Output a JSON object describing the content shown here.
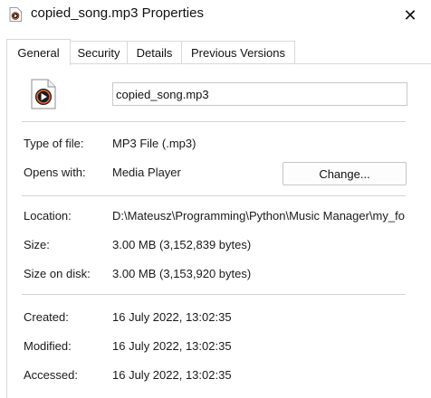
{
  "window": {
    "title": "copied_song.mp3 Properties",
    "close_symbol": "✕"
  },
  "tabs": [
    {
      "label": "General",
      "active": true
    },
    {
      "label": "Security",
      "active": false
    },
    {
      "label": "Details",
      "active": false
    },
    {
      "label": "Previous Versions",
      "active": false
    }
  ],
  "general": {
    "file_name": "copied_song.mp3",
    "type_label": "Type of file:",
    "type_value": "MP3 File (.mp3)",
    "opens_label": "Opens with:",
    "opens_value": "Media Player",
    "change_button": "Change...",
    "location_label": "Location:",
    "location_value": "D:\\Mateusz\\Programming\\Python\\Music Manager\\my_fo",
    "size_label": "Size:",
    "size_value": "3.00 MB (3,152,839 bytes)",
    "size_disk_label": "Size on disk:",
    "size_disk_value": "3.00 MB (3,153,920 bytes)",
    "created_label": "Created:",
    "created_value": "16 July 2022, 13:02:35",
    "modified_label": "Modified:",
    "modified_value": "16 July 2022, 13:02:35",
    "accessed_label": "Accessed:",
    "accessed_value": "16 July 2022, 13:02:35"
  },
  "icons": {
    "app": "media-file-icon",
    "file": "media-file-icon",
    "close": "close-icon"
  },
  "colors": {
    "accent_orange": "#e8662a",
    "icon_dark": "#1b1b1b",
    "border": "#d9d9d9"
  }
}
